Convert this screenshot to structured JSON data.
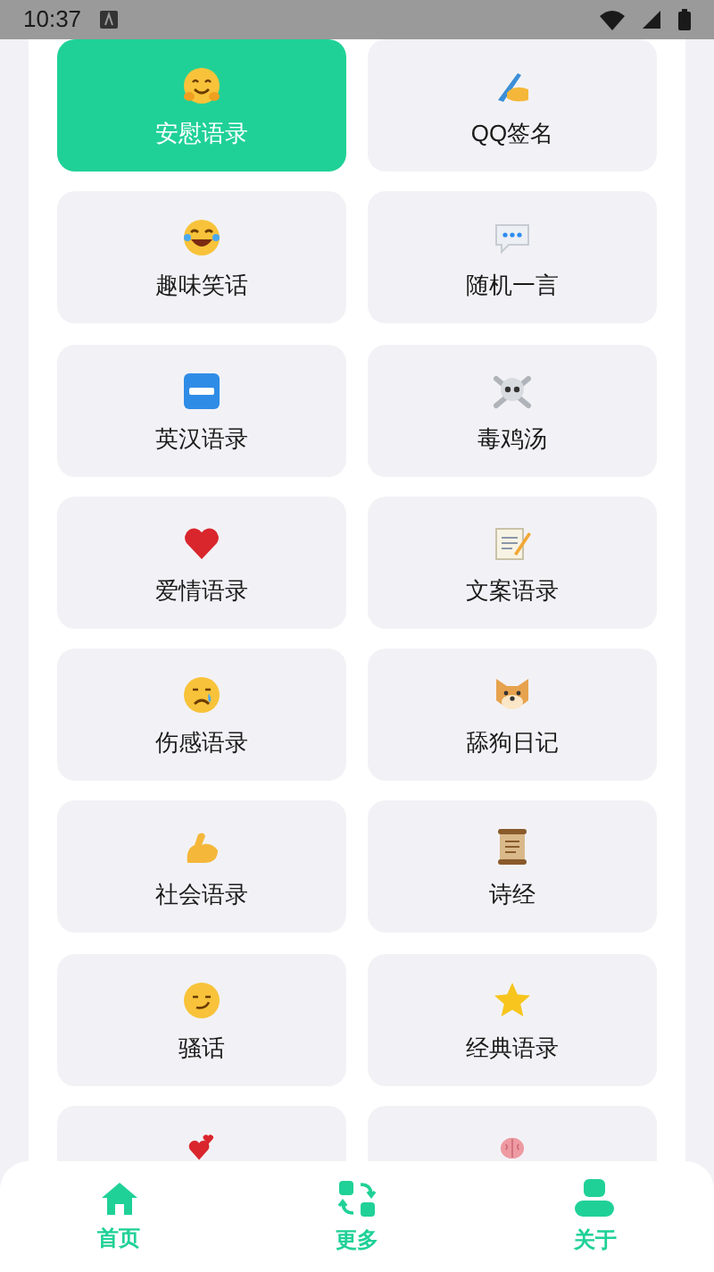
{
  "status_bar": {
    "time": "10:37"
  },
  "items": [
    {
      "label": "安慰语录",
      "selected": true
    },
    {
      "label": "QQ签名",
      "selected": false
    },
    {
      "label": "趣味笑话",
      "selected": false
    },
    {
      "label": "随机一言",
      "selected": false
    },
    {
      "label": "英汉语录",
      "selected": false
    },
    {
      "label": "毒鸡汤",
      "selected": false
    },
    {
      "label": "爱情语录",
      "selected": false
    },
    {
      "label": "文案语录",
      "selected": false
    },
    {
      "label": "伤感语录",
      "selected": false
    },
    {
      "label": "舔狗日记",
      "selected": false
    },
    {
      "label": "社会语录",
      "selected": false
    },
    {
      "label": "诗经",
      "selected": false
    },
    {
      "label": "骚话",
      "selected": false
    },
    {
      "label": "经典语录",
      "selected": false
    },
    {
      "selected": false
    },
    {
      "selected": false
    }
  ],
  "bottom_nav": [
    {
      "label": "首页"
    },
    {
      "label": "更多"
    },
    {
      "label": "关于"
    }
  ]
}
